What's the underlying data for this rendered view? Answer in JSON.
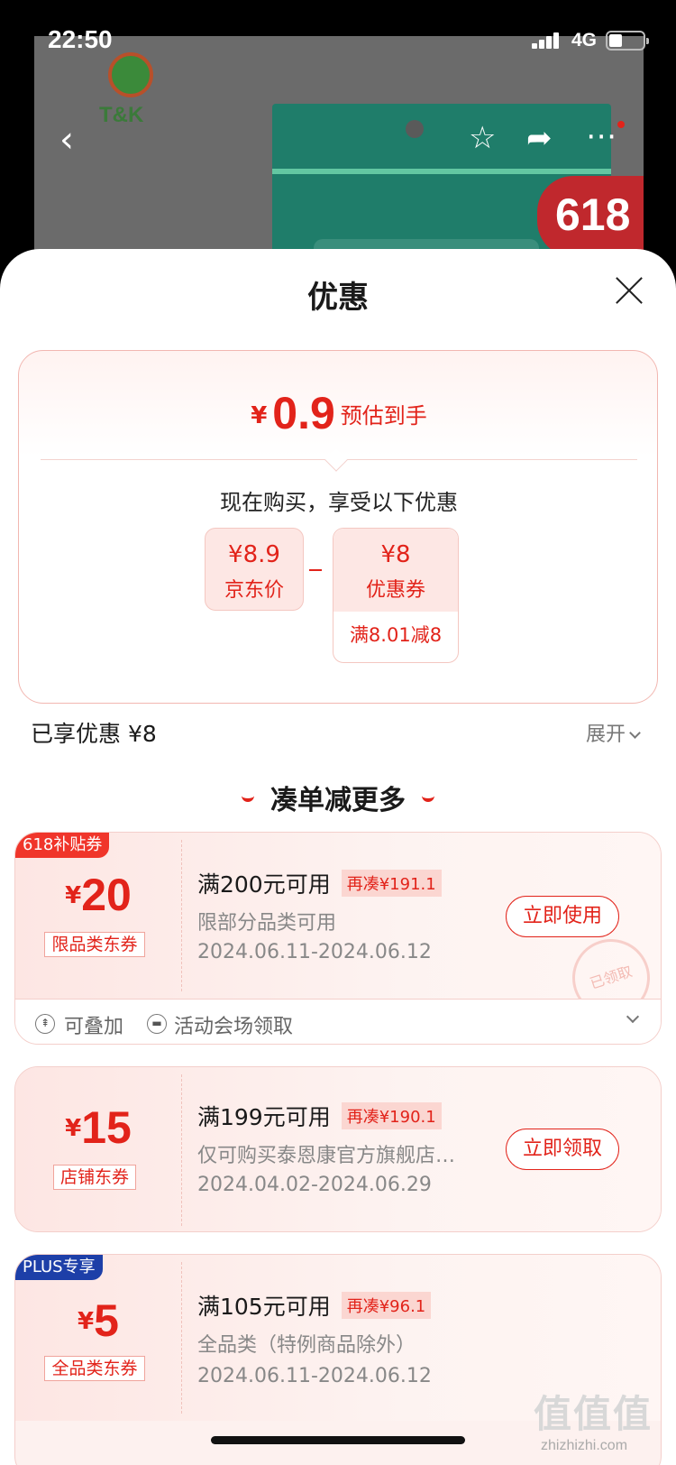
{
  "status_bar": {
    "time": "22:50",
    "network": "4G"
  },
  "backdrop": {
    "brand_text": "T&K",
    "badge": "618"
  },
  "sheet": {
    "title": "优惠",
    "estimate": {
      "yen": "¥",
      "amount": "0.9",
      "label": "预估到手"
    },
    "buy_intro": "现在购买，享受以下优惠",
    "jd_price": {
      "value": "¥8.9",
      "label": "京东价"
    },
    "coupon_price": {
      "value": "¥8",
      "label": "优惠券",
      "condition": "满8.01减8"
    },
    "enjoyed": "已享优惠 ¥8",
    "expand": "展开",
    "more_heading": "凑单减更多"
  },
  "coupons": [
    {
      "tag": "618补贴券",
      "yen": "¥",
      "value": "20",
      "category": "限品类东券",
      "rule": "满200元可用",
      "gap": "再凑¥191.1",
      "scope": "限部分品类可用",
      "dates": "2024.06.11-2024.06.12",
      "button": "立即使用",
      "stamp": "已领取",
      "footer": {
        "stackable": "可叠加",
        "source": "活动会场领取"
      }
    },
    {
      "yen": "¥",
      "value": "15",
      "category": "店铺东券",
      "rule": "满199元可用",
      "gap": "再凑¥190.1",
      "scope": "仅可购买泰恩康官方旗舰店…",
      "dates": "2024.04.02-2024.06.29",
      "button": "立即领取"
    },
    {
      "tag": "PLUS专享",
      "yen": "¥",
      "value": "5",
      "category": "全品类东券",
      "rule": "满105元可用",
      "gap": "再凑¥96.1",
      "scope": "全品类（特例商品除外）",
      "dates": "2024.06.11-2024.06.12"
    }
  ],
  "watermark": {
    "big": "值值值",
    "small": "zhizhizhi.com"
  },
  "colors": {
    "accent": "#e2231a",
    "plus_tag": "#1d3fa8"
  }
}
